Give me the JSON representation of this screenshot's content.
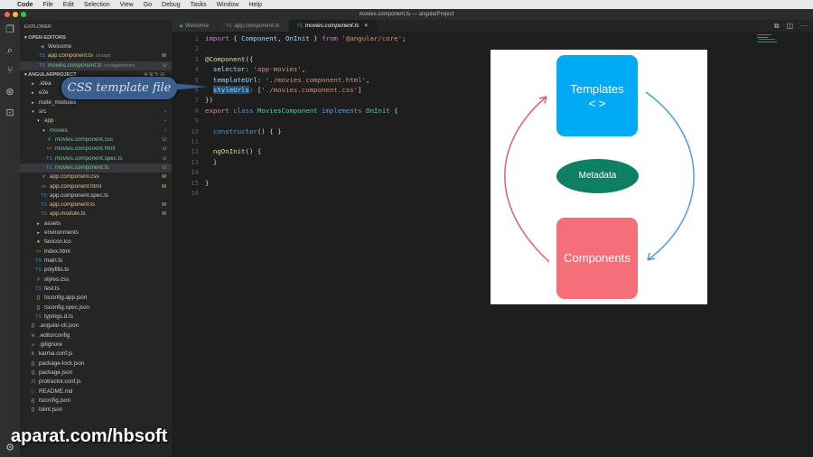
{
  "menubar": {
    "app": "Code",
    "items": [
      "File",
      "Edit",
      "Selection",
      "View",
      "Go",
      "Debug",
      "Tasks",
      "Window",
      "Help"
    ]
  },
  "window_title": "movies.component.ts — angularProject",
  "sidebar": {
    "title": "EXPLORER",
    "open_editors_label": "OPEN EDITORS",
    "open_editors": [
      {
        "label": "Welcome",
        "icon": "vscode",
        "status": "",
        "sub": "",
        "badge": ""
      },
      {
        "label": "app.component.ts",
        "icon": "ts",
        "status": "M",
        "sub": "src/app",
        "badge": "M"
      },
      {
        "label": "movies.component.ts",
        "icon": "ts",
        "status": "U",
        "sub": "src/app/movies",
        "badge": "U"
      }
    ],
    "project_label": "ANGULARPROJECT",
    "tree": [
      {
        "label": ".idea",
        "icon": "folder",
        "depth": 1,
        "status": "",
        "badge": ""
      },
      {
        "label": "e2e",
        "icon": "folder",
        "depth": 1,
        "status": "",
        "badge": ""
      },
      {
        "label": "node_modules",
        "icon": "folder",
        "depth": 1,
        "status": "",
        "badge": ""
      },
      {
        "label": "src",
        "icon": "folder-open",
        "depth": 1,
        "status": "",
        "badge": "•"
      },
      {
        "label": "app",
        "icon": "folder-open",
        "depth": 2,
        "status": "M",
        "badge": "•"
      },
      {
        "label": "movies",
        "icon": "folder-open",
        "depth": 3,
        "status": "U",
        "badge": "•"
      },
      {
        "label": "movies.component.css",
        "icon": "css",
        "depth": 4,
        "status": "U",
        "badge": "U"
      },
      {
        "label": "movies.component.html",
        "icon": "html",
        "depth": 4,
        "status": "U",
        "badge": "U"
      },
      {
        "label": "movies.component.spec.ts",
        "icon": "ts",
        "depth": 4,
        "status": "U",
        "badge": "U"
      },
      {
        "label": "movies.component.ts",
        "icon": "ts",
        "depth": 4,
        "status": "U",
        "badge": "U",
        "selected": true
      },
      {
        "label": "app.component.css",
        "icon": "css",
        "depth": 3,
        "status": "M",
        "badge": "M"
      },
      {
        "label": "app.component.html",
        "icon": "html",
        "depth": 3,
        "status": "M",
        "badge": "M"
      },
      {
        "label": "app.component.spec.ts",
        "icon": "ts",
        "depth": 3,
        "status": "",
        "badge": ""
      },
      {
        "label": "app.component.ts",
        "icon": "ts",
        "depth": 3,
        "status": "M",
        "badge": "M"
      },
      {
        "label": "app.module.ts",
        "icon": "ts",
        "depth": 3,
        "status": "M",
        "badge": "M"
      },
      {
        "label": "assets",
        "icon": "folder",
        "depth": 2,
        "status": "",
        "badge": ""
      },
      {
        "label": "environments",
        "icon": "folder",
        "depth": 2,
        "status": "",
        "badge": ""
      },
      {
        "label": "favicon.ico",
        "icon": "star",
        "depth": 2,
        "status": "",
        "badge": ""
      },
      {
        "label": "index.html",
        "icon": "html",
        "depth": 2,
        "status": "",
        "badge": ""
      },
      {
        "label": "main.ts",
        "icon": "ts",
        "depth": 2,
        "status": "",
        "badge": ""
      },
      {
        "label": "polyfills.ts",
        "icon": "ts",
        "depth": 2,
        "status": "",
        "badge": ""
      },
      {
        "label": "styles.css",
        "icon": "css",
        "depth": 2,
        "status": "",
        "badge": ""
      },
      {
        "label": "test.ts",
        "icon": "ts",
        "depth": 2,
        "status": "",
        "badge": ""
      },
      {
        "label": "tsconfig.app.json",
        "icon": "json",
        "depth": 2,
        "status": "",
        "badge": ""
      },
      {
        "label": "tsconfig.spec.json",
        "icon": "json",
        "depth": 2,
        "status": "",
        "badge": ""
      },
      {
        "label": "typings.d.ts",
        "icon": "ts",
        "depth": 2,
        "status": "",
        "badge": ""
      },
      {
        "label": ".angular-cli.json",
        "icon": "json",
        "depth": 1,
        "status": "",
        "badge": ""
      },
      {
        "label": ".editorconfig",
        "icon": "gear",
        "depth": 1,
        "status": "",
        "badge": ""
      },
      {
        "label": ".gitignore",
        "icon": "git",
        "depth": 1,
        "status": "",
        "badge": ""
      },
      {
        "label": "karma.conf.js",
        "icon": "karma",
        "depth": 1,
        "status": "",
        "badge": ""
      },
      {
        "label": "package-lock.json",
        "icon": "json",
        "depth": 1,
        "status": "",
        "badge": ""
      },
      {
        "label": "package.json",
        "icon": "json",
        "depth": 1,
        "status": "",
        "badge": ""
      },
      {
        "label": "protractor.conf.js",
        "icon": "js",
        "depth": 1,
        "status": "",
        "badge": ""
      },
      {
        "label": "README.md",
        "icon": "info",
        "depth": 1,
        "status": "",
        "badge": ""
      },
      {
        "label": "tsconfig.json",
        "icon": "json",
        "depth": 1,
        "status": "",
        "badge": ""
      },
      {
        "label": "tslint.json",
        "icon": "json",
        "depth": 1,
        "status": "",
        "badge": ""
      }
    ]
  },
  "tabs": [
    {
      "label": "Welcome",
      "icon": "vscode",
      "active": false
    },
    {
      "label": "app.component.ts",
      "icon": "ts",
      "active": false
    },
    {
      "label": "movies.component.ts",
      "icon": "ts",
      "active": true,
      "close": "×"
    }
  ],
  "code": [
    [
      [
        "import",
        "kw"
      ],
      [
        " { ",
        ""
      ],
      [
        "Component",
        "prop"
      ],
      [
        ", ",
        ""
      ],
      [
        "OnInit",
        "prop"
      ],
      [
        " } ",
        ""
      ],
      [
        "from",
        "kw"
      ],
      [
        " ",
        ""
      ],
      [
        "'@angular/core'",
        "str"
      ],
      [
        ";",
        ""
      ]
    ],
    [],
    [
      [
        "@",
        ""
      ],
      [
        "Component",
        "fn"
      ],
      [
        "({",
        ""
      ]
    ],
    [
      [
        "  ",
        ""
      ],
      [
        "selector",
        "prop"
      ],
      [
        ": ",
        ""
      ],
      [
        "'app-movies'",
        "str"
      ],
      [
        ",",
        ""
      ]
    ],
    [
      [
        "  ",
        ""
      ],
      [
        "templateUrl",
        "prop"
      ],
      [
        ": ",
        ""
      ],
      [
        "'./movies.component.html'",
        "str"
      ],
      [
        ",",
        ""
      ]
    ],
    [
      [
        "  ",
        ""
      ],
      [
        "styleUrls",
        "hl"
      ],
      [
        ": [",
        ""
      ],
      [
        "'./movies.component.css'",
        "str"
      ],
      [
        "]",
        ""
      ]
    ],
    [
      [
        "})",
        ""
      ]
    ],
    [
      [
        "export",
        "kw"
      ],
      [
        " ",
        ""
      ],
      [
        "class",
        "kb"
      ],
      [
        " ",
        ""
      ],
      [
        "MoviesComponent",
        "cls"
      ],
      [
        " ",
        ""
      ],
      [
        "implements",
        "kb"
      ],
      [
        " ",
        ""
      ],
      [
        "OnInit",
        "cls"
      ],
      [
        " {",
        ""
      ]
    ],
    [],
    [
      [
        "  ",
        ""
      ],
      [
        "constructor",
        "kb"
      ],
      [
        "() { }",
        ""
      ]
    ],
    [],
    [
      [
        "  ",
        ""
      ],
      [
        "ngOnInit",
        "fn"
      ],
      [
        "() {",
        ""
      ]
    ],
    [
      [
        "  }",
        ""
      ]
    ],
    [],
    [
      [
        "}",
        ""
      ]
    ],
    []
  ],
  "callout": "CSS template file",
  "diagram": {
    "templates": "Templates",
    "templates_glyph": "< >",
    "metadata": "Metadata",
    "components": "Components",
    "colors": {
      "templates": "#00aaf5",
      "metadata": "#0f7f63",
      "components": "#f46f7a",
      "arrow_left": "#e06070",
      "arrow_right": "#4a9ee0"
    }
  },
  "watermark": "aparat.com/hbsoft"
}
